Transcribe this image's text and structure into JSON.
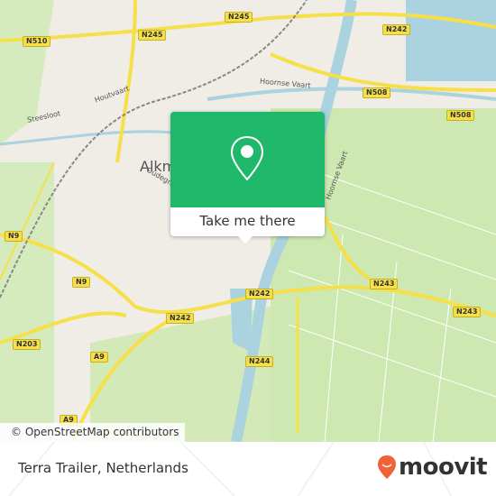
{
  "map": {
    "city_label": "Alkm",
    "road_shields": [
      "N245",
      "N245",
      "N510",
      "N242",
      "N508",
      "N508",
      "N9",
      "N9",
      "N242",
      "N242",
      "N203",
      "A9",
      "A9",
      "N243",
      "N243",
      "N244"
    ],
    "street_labels": [
      "Steesloot",
      "Houtvaart",
      "Hoornse Vaart",
      "Oudegracht",
      "Hoornse Vaart"
    ],
    "attribution": "© OpenStreetMap contributors",
    "colors": {
      "water": "#aad3df",
      "green": "#cde8b0",
      "road": "#f6e04a",
      "land": "#f0ece6"
    }
  },
  "popup": {
    "icon": "map-pin-icon",
    "button_label": "Take me there",
    "color": "#1fb76a"
  },
  "footer": {
    "place_name": "Terra Trailer, Netherlands",
    "logo_text": "moovit",
    "logo_color": "#f0623a"
  }
}
